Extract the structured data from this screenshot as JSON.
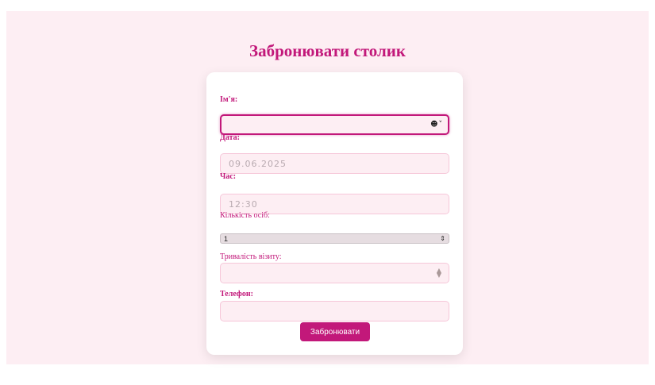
{
  "page": {
    "title": "Забронювати столик"
  },
  "form": {
    "name": {
      "label": "Ім'я:",
      "value": ""
    },
    "date": {
      "label": "Дата:",
      "value": "09.06.2025"
    },
    "time": {
      "label": "Час:",
      "value": "12:30"
    },
    "guests": {
      "label": "Кількість осіб:",
      "value": "1"
    },
    "duration": {
      "label": "Тривалість візиту:",
      "value": ""
    },
    "phone": {
      "label": "Телефон:",
      "value": ""
    },
    "submit_label": "Забронювати"
  },
  "icons": {
    "autofill": "contact-autofill-icon",
    "select_arrows": "updown-arrows-icon",
    "stepper": "number-stepper-icon"
  },
  "colors": {
    "accent": "#c2187a",
    "page_bg": "#fdeef3",
    "input_bg": "#fdeef3",
    "input_border": "#f6c7d9",
    "card_bg": "#ffffff"
  }
}
